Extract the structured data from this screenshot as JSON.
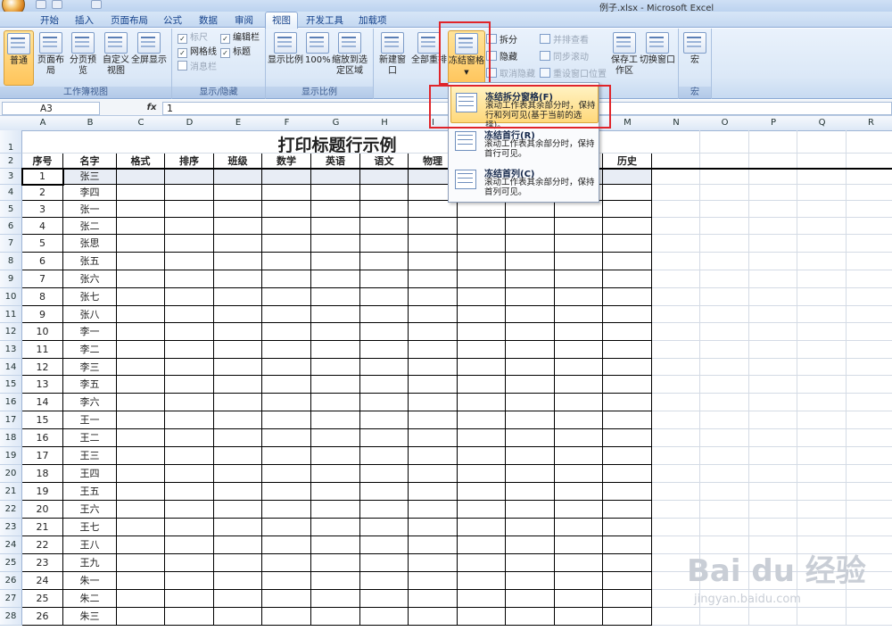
{
  "window": {
    "title": "例子.xlsx - Microsoft Excel"
  },
  "tabs": [
    "开始",
    "插入",
    "页面布局",
    "公式",
    "数据",
    "审阅",
    "视图",
    "开发工具",
    "加载项"
  ],
  "ribbon": {
    "views_group": {
      "label": "工作簿视图",
      "buttons": [
        "普通",
        "页面布局",
        "分页预览",
        "自定义视图",
        "全屏显示"
      ]
    },
    "show_group": {
      "label": "显示/隐藏",
      "items": [
        {
          "label": "标尺",
          "checked": true,
          "disabled": true
        },
        {
          "label": "网格线",
          "checked": true,
          "disabled": false
        },
        {
          "label": "消息栏",
          "checked": false,
          "disabled": true
        },
        {
          "label": "编辑栏",
          "checked": true,
          "disabled": false
        },
        {
          "label": "标题",
          "checked": true,
          "disabled": false
        }
      ]
    },
    "zoom_group": {
      "label": "显示比例",
      "buttons": [
        "显示比例",
        "100%",
        "缩放到选定区域"
      ]
    },
    "window_group": {
      "buttons": [
        "新建窗口",
        "全部重排",
        "冻结窗格"
      ],
      "small": [
        "拆分",
        "隐藏",
        "取消隐藏",
        "并排查看",
        "同步滚动",
        "重设窗口位置"
      ],
      "save": "保存工作区",
      "switch": "切换窗口"
    },
    "macro_group": {
      "label": "宏",
      "button": "宏"
    }
  },
  "formula_bar": {
    "name_box": "A3",
    "fx": "fx",
    "value": "1"
  },
  "freeze_menu": [
    {
      "title": "冻结拆分窗格(F)",
      "desc": "滚动工作表其余部分时，保持行和列可见(基于当前的选择)。"
    },
    {
      "title": "冻结首行(R)",
      "desc": "滚动工作表其余部分时，保持首行可见。"
    },
    {
      "title": "冻结首列(C)",
      "desc": "滚动工作表其余部分时，保持首列可见。"
    }
  ],
  "sheet": {
    "columns": [
      "A",
      "B",
      "C",
      "D",
      "E",
      "F",
      "G",
      "H",
      "I",
      "J",
      "K",
      "L",
      "M",
      "N",
      "O",
      "P",
      "Q",
      "R"
    ],
    "title": "打印标题行示例",
    "headers": [
      "序号",
      "名字",
      "格式",
      "排序",
      "班级",
      "数学",
      "英语",
      "语文",
      "物理",
      "",
      "",
      "",
      "历史"
    ],
    "rows": [
      [
        "1",
        "张三"
      ],
      [
        "2",
        "李四"
      ],
      [
        "3",
        "张一"
      ],
      [
        "4",
        "张二"
      ],
      [
        "5",
        "张思"
      ],
      [
        "6",
        "张五"
      ],
      [
        "7",
        "张六"
      ],
      [
        "8",
        "张七"
      ],
      [
        "9",
        "张八"
      ],
      [
        "10",
        "李一"
      ],
      [
        "11",
        "李二"
      ],
      [
        "12",
        "李三"
      ],
      [
        "13",
        "李五"
      ],
      [
        "14",
        "李六"
      ],
      [
        "15",
        "王一"
      ],
      [
        "16",
        "王二"
      ],
      [
        "17",
        "王三"
      ],
      [
        "18",
        "王四"
      ],
      [
        "19",
        "王五"
      ],
      [
        "20",
        "王六"
      ],
      [
        "21",
        "王七"
      ],
      [
        "22",
        "王八"
      ],
      [
        "23",
        "王九"
      ],
      [
        "24",
        "朱一"
      ],
      [
        "25",
        "朱二"
      ],
      [
        "26",
        "朱三"
      ]
    ]
  },
  "watermark": {
    "logo": "Bai du 经验",
    "url": "jingyan.baidu.com"
  }
}
